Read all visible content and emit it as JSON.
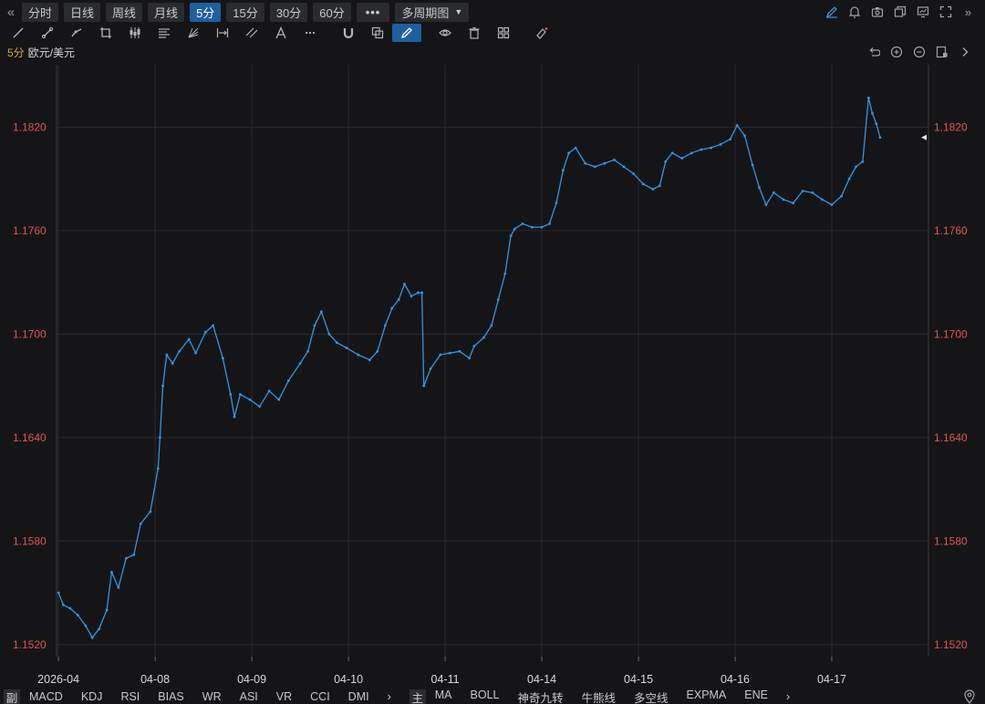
{
  "period_bar": {
    "collapse_icon": "«",
    "expand_icon": "»",
    "tabs": [
      {
        "label": "分时",
        "active": false
      },
      {
        "label": "日线",
        "active": false
      },
      {
        "label": "周线",
        "active": false
      },
      {
        "label": "月线",
        "active": false
      },
      {
        "label": "5分",
        "active": true
      },
      {
        "label": "15分",
        "active": false
      },
      {
        "label": "30分",
        "active": false
      },
      {
        "label": "60分",
        "active": false
      }
    ],
    "more_label": "•••",
    "multi_period_label": "多周期图"
  },
  "symbol": {
    "period": "5分",
    "name": "欧元/美元"
  },
  "colors": {
    "background": "#151517",
    "line": "#2f96e8",
    "price_label": "#e05454",
    "axis_text": "#d8d9dc",
    "grid": "#2a2b2f",
    "accent": "#1e5fa0"
  },
  "indicators": {
    "sub_tag": "副",
    "sub_items": [
      "MACD",
      "KDJ",
      "RSI",
      "BIAS",
      "WR",
      "ASI",
      "VR",
      "CCI",
      "DMI"
    ],
    "main_tag": "主",
    "main_items": [
      "MA",
      "BOLL",
      "神奇九转",
      "牛熊线",
      "多空线",
      "EXPMA",
      "ENE"
    ],
    "arrow": "›"
  },
  "chart_data": {
    "type": "line",
    "title": "",
    "xlabel": "",
    "ylabel": "",
    "y_tick_labels": [
      "1.1520",
      "1.1580",
      "1.1640",
      "1.1700",
      "1.1760",
      "1.1820"
    ],
    "ylim": [
      1.1513,
      1.1853
    ],
    "x_tick_labels": [
      "2026-04",
      "04-08",
      "04-09",
      "04-10",
      "04-11",
      "04-14",
      "04-15",
      "04-16",
      "04-17"
    ],
    "x_tick_positions": [
      0,
      1,
      2,
      3,
      4,
      5,
      6,
      7,
      8
    ],
    "xlim": [
      -0.02,
      9.0
    ],
    "current_price": 1.1814,
    "series": [
      {
        "points": [
          [
            0.0,
            1.155
          ],
          [
            0.05,
            1.1543
          ],
          [
            0.12,
            1.1541
          ],
          [
            0.2,
            1.1537
          ],
          [
            0.28,
            1.1531
          ],
          [
            0.35,
            1.1524
          ],
          [
            0.42,
            1.1529
          ],
          [
            0.5,
            1.154
          ],
          [
            0.55,
            1.1562
          ],
          [
            0.62,
            1.1553
          ],
          [
            0.7,
            1.157
          ],
          [
            0.78,
            1.1572
          ],
          [
            0.85,
            1.159
          ],
          [
            0.95,
            1.1597
          ],
          [
            1.03,
            1.1622
          ],
          [
            1.05,
            1.164
          ],
          [
            1.08,
            1.167
          ],
          [
            1.12,
            1.1688
          ],
          [
            1.18,
            1.1683
          ],
          [
            1.25,
            1.169
          ],
          [
            1.35,
            1.1697
          ],
          [
            1.42,
            1.1689
          ],
          [
            1.52,
            1.1701
          ],
          [
            1.6,
            1.1705
          ],
          [
            1.7,
            1.1686
          ],
          [
            1.78,
            1.1665
          ],
          [
            1.82,
            1.1652
          ],
          [
            1.88,
            1.1665
          ],
          [
            1.98,
            1.1662
          ],
          [
            2.08,
            1.1658
          ],
          [
            2.18,
            1.1667
          ],
          [
            2.28,
            1.1662
          ],
          [
            2.38,
            1.1673
          ],
          [
            2.5,
            1.1683
          ],
          [
            2.58,
            1.169
          ],
          [
            2.65,
            1.1705
          ],
          [
            2.72,
            1.1713
          ],
          [
            2.8,
            1.17
          ],
          [
            2.88,
            1.1695
          ],
          [
            2.98,
            1.1692
          ],
          [
            3.1,
            1.1688
          ],
          [
            3.22,
            1.1685
          ],
          [
            3.3,
            1.169
          ],
          [
            3.38,
            1.1705
          ],
          [
            3.45,
            1.1715
          ],
          [
            3.52,
            1.172
          ],
          [
            3.58,
            1.1729
          ],
          [
            3.65,
            1.1722
          ],
          [
            3.72,
            1.1724
          ],
          [
            3.76,
            1.1724
          ],
          [
            3.78,
            1.167
          ],
          [
            3.85,
            1.168
          ],
          [
            3.95,
            1.1688
          ],
          [
            4.05,
            1.1689
          ],
          [
            4.15,
            1.169
          ],
          [
            4.25,
            1.1686
          ],
          [
            4.3,
            1.1693
          ],
          [
            4.4,
            1.1698
          ],
          [
            4.48,
            1.1705
          ],
          [
            4.55,
            1.172
          ],
          [
            4.62,
            1.1735
          ],
          [
            4.68,
            1.1757
          ],
          [
            4.72,
            1.1761
          ],
          [
            4.8,
            1.1764
          ],
          [
            4.9,
            1.1762
          ],
          [
            5.0,
            1.1762
          ],
          [
            5.08,
            1.1764
          ],
          [
            5.15,
            1.1776
          ],
          [
            5.22,
            1.1795
          ],
          [
            5.28,
            1.1805
          ],
          [
            5.35,
            1.1808
          ],
          [
            5.45,
            1.1799
          ],
          [
            5.55,
            1.1797
          ],
          [
            5.65,
            1.1799
          ],
          [
            5.75,
            1.1801
          ],
          [
            5.85,
            1.1797
          ],
          [
            5.95,
            1.1793
          ],
          [
            6.05,
            1.1787
          ],
          [
            6.15,
            1.1784
          ],
          [
            6.22,
            1.1786
          ],
          [
            6.28,
            1.18
          ],
          [
            6.35,
            1.1805
          ],
          [
            6.45,
            1.1802
          ],
          [
            6.55,
            1.1805
          ],
          [
            6.65,
            1.1807
          ],
          [
            6.75,
            1.1808
          ],
          [
            6.85,
            1.181
          ],
          [
            6.95,
            1.1813
          ],
          [
            7.02,
            1.1821
          ],
          [
            7.1,
            1.1815
          ],
          [
            7.18,
            1.1798
          ],
          [
            7.25,
            1.1785
          ],
          [
            7.32,
            1.1775
          ],
          [
            7.4,
            1.1782
          ],
          [
            7.5,
            1.1778
          ],
          [
            7.6,
            1.1776
          ],
          [
            7.7,
            1.1783
          ],
          [
            7.8,
            1.1782
          ],
          [
            7.9,
            1.1778
          ],
          [
            8.0,
            1.1775
          ],
          [
            8.1,
            1.178
          ],
          [
            8.18,
            1.179
          ],
          [
            8.25,
            1.1797
          ],
          [
            8.32,
            1.18
          ],
          [
            8.38,
            1.1837
          ],
          [
            8.42,
            1.1828
          ],
          [
            8.46,
            1.1822
          ],
          [
            8.5,
            1.1814
          ]
        ]
      }
    ]
  }
}
